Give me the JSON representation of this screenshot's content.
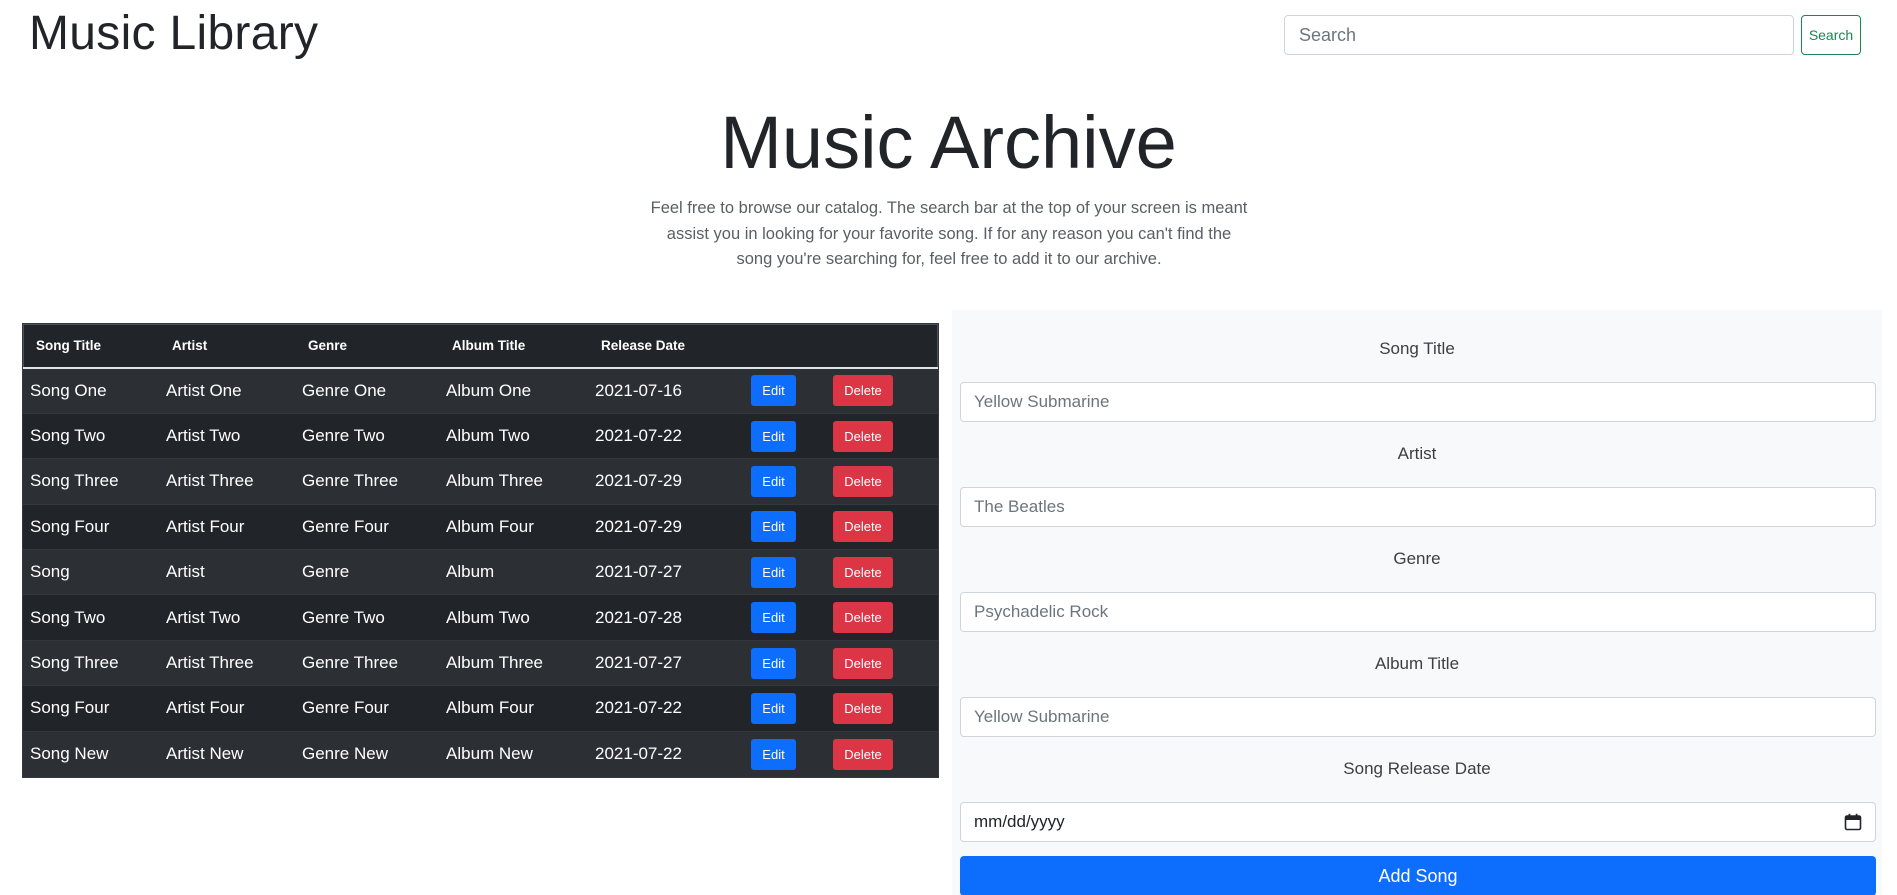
{
  "header": {
    "brand": "Music Library",
    "search_placeholder": "Search",
    "search_button": "Search"
  },
  "hero": {
    "title": "Music Archive",
    "text": "Feel free to browse our catalog. The search bar at the top of your screen is meant assist you in looking for your favorite song. If for any reason you can't find the song you're searching for, feel free to add it to our archive."
  },
  "table": {
    "columns": [
      "Song Title",
      "Artist",
      "Genre",
      "Album Title",
      "Release Date"
    ],
    "edit_label": "Edit",
    "delete_label": "Delete",
    "rows": [
      [
        "Song One",
        "Artist One",
        "Genre One",
        "Album One",
        "2021-07-16"
      ],
      [
        "Song Two",
        "Artist Two",
        "Genre Two",
        "Album Two",
        "2021-07-22"
      ],
      [
        "Song Three",
        "Artist Three",
        "Genre Three",
        "Album Three",
        "2021-07-29"
      ],
      [
        "Song Four",
        "Artist Four",
        "Genre Four",
        "Album Four",
        "2021-07-29"
      ],
      [
        "Song",
        "Artist",
        "Genre",
        "Album",
        "2021-07-27"
      ],
      [
        "Song Two",
        "Artist Two",
        "Genre Two",
        "Album Two",
        "2021-07-28"
      ],
      [
        "Song Three",
        "Artist Three",
        "Genre Three",
        "Album Three",
        "2021-07-27"
      ],
      [
        "Song Four",
        "Artist Four",
        "Genre Four",
        "Album Four",
        "2021-07-22"
      ],
      [
        "Song New",
        "Artist New",
        "Genre New",
        "Album New",
        "2021-07-22"
      ]
    ]
  },
  "form": {
    "song_title_label": "Song Title",
    "song_title_placeholder": "Yellow Submarine",
    "artist_label": "Artist",
    "artist_placeholder": "The Beatles",
    "genre_label": "Genre",
    "genre_placeholder": "Psychadelic Rock",
    "album_label": "Album Title",
    "album_placeholder": "Yellow Submarine",
    "date_label": "Song Release Date",
    "date_placeholder": "mm/dd/yyyy",
    "submit_label": "Add Song"
  },
  "colors": {
    "primary": "#0d6efd",
    "danger": "#dc3545",
    "success": "#198754",
    "table_dark": "#212529",
    "panel_bg": "#f8f9fa"
  },
  "icons": {
    "date_picker": "calendar-icon"
  }
}
